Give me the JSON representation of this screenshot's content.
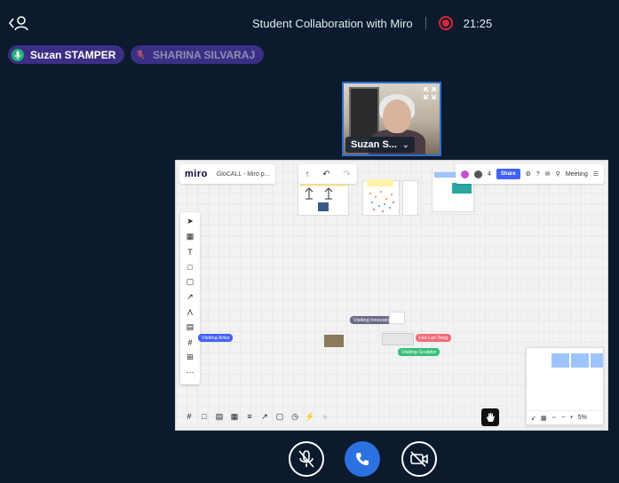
{
  "header": {
    "title": "Student Collaboration with Miro",
    "timer": "21:25",
    "recording_color": "#d9263a"
  },
  "participants": [
    {
      "name": "Suzan STAMPER",
      "mic": "on",
      "mic_color": "#24b27a"
    },
    {
      "name": "SHARINA SILVARAJ",
      "mic": "muted"
    }
  ],
  "video_tile": {
    "label": "Suzan S..."
  },
  "miro": {
    "logo": "miro",
    "board_name": "GloCALL - Miro p...",
    "share_label": "Share",
    "meeting_label": "Meeting",
    "participant_count": "4",
    "cursors": [
      {
        "label": "Visiting Innovator",
        "color": "#6b6b8a"
      },
      {
        "label": "Visiting Artist",
        "color": "#4262ff"
      },
      {
        "label": "Hui Lan Teng",
        "color": "#f26d7d"
      },
      {
        "label": "Visiting Sculptor",
        "color": "#35c07a"
      }
    ],
    "zoom": "5%"
  },
  "controls": {
    "mic": "mic-off-icon",
    "leave": "phone-icon",
    "camera": "camera-off-icon",
    "leave_color": "#2b71e0"
  }
}
